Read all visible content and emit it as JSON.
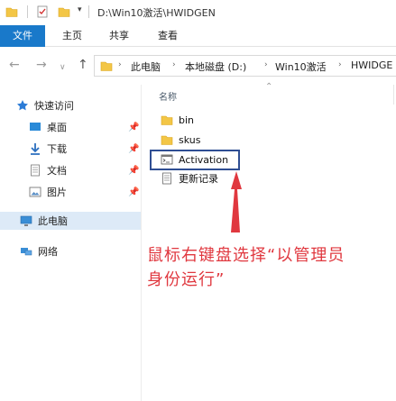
{
  "titlebar": {
    "title": "D:\\Win10激活\\HWIDGEN",
    "dropdown_glyph": "▾"
  },
  "ribbon": {
    "tabs": [
      {
        "label": "文件",
        "active": true
      },
      {
        "label": "主页",
        "active": false
      },
      {
        "label": "共享",
        "active": false
      },
      {
        "label": "查看",
        "active": false
      }
    ]
  },
  "address_bar": {
    "crumbs": [
      "此电脑",
      "本地磁盘 (D:)",
      "Win10激活",
      "HWIDGE"
    ]
  },
  "nav_pane": {
    "quick_access": "快速访问",
    "items": [
      {
        "label": "桌面",
        "icon": "desktop-icon",
        "pinned": true
      },
      {
        "label": "下载",
        "icon": "download-icon",
        "pinned": true
      },
      {
        "label": "文档",
        "icon": "document-icon",
        "pinned": true
      },
      {
        "label": "图片",
        "icon": "pictures-icon",
        "pinned": true
      }
    ],
    "this_pc": "此电脑",
    "network": "网络"
  },
  "content": {
    "column_header": "名称",
    "files": [
      {
        "name": "bin",
        "icon": "folder-icon"
      },
      {
        "name": "skus",
        "icon": "folder-icon"
      },
      {
        "name": "Activation",
        "icon": "batch-file-icon"
      },
      {
        "name": "更新记录",
        "icon": "text-file-icon"
      }
    ]
  },
  "annotation": {
    "line1": "鼠标右键盘选择“以管理员",
    "line2": "身份运行”",
    "color": "#e0383f"
  },
  "colors": {
    "accent": "#1979ca",
    "highlight_box": "#2f4e93",
    "selection": "#ddeaf7",
    "folder": "#f3c646"
  }
}
